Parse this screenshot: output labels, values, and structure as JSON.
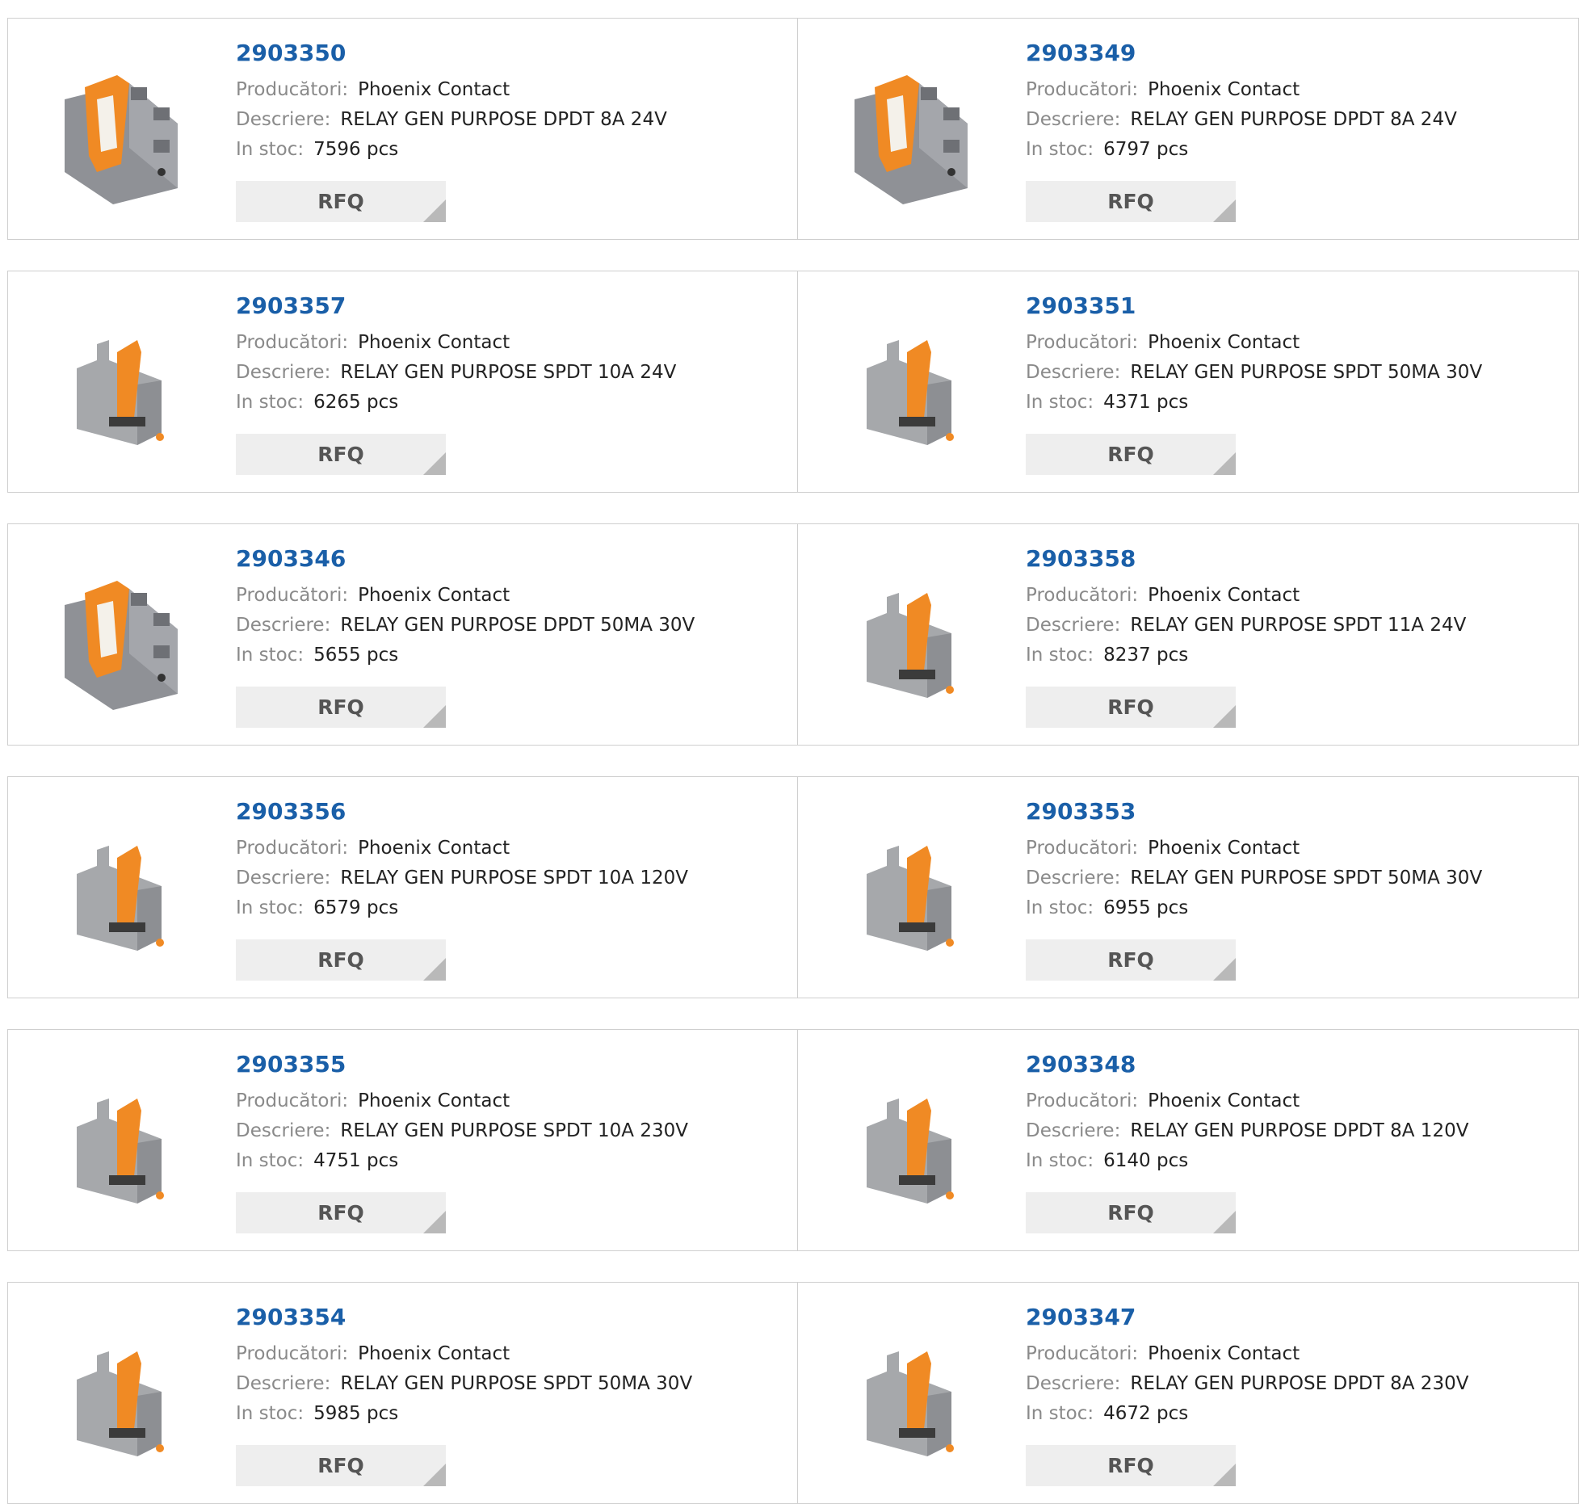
{
  "labels": {
    "manufacturer": "Producători:",
    "description": "Descriere:",
    "stock": "In stoc:",
    "rfq": "RFQ"
  },
  "products": [
    {
      "part": "2903350",
      "manufacturer": "Phoenix Contact",
      "description": "RELAY GEN PURPOSE DPDT 8A 24V",
      "stock": "7596 pcs",
      "image": "relay-dpdt-icon"
    },
    {
      "part": "2903349",
      "manufacturer": "Phoenix Contact",
      "description": "RELAY GEN PURPOSE DPDT 8A 24V",
      "stock": "6797 pcs",
      "image": "relay-dpdt-icon"
    },
    {
      "part": "2903357",
      "manufacturer": "Phoenix Contact",
      "description": "RELAY GEN PURPOSE SPDT 10A 24V",
      "stock": "6265 pcs",
      "image": "relay-spdt-icon"
    },
    {
      "part": "2903351",
      "manufacturer": "Phoenix Contact",
      "description": "RELAY GEN PURPOSE SPDT 50MA 30V",
      "stock": "4371 pcs",
      "image": "relay-spdt-icon"
    },
    {
      "part": "2903346",
      "manufacturer": "Phoenix Contact",
      "description": "RELAY GEN PURPOSE DPDT 50MA 30V",
      "stock": "5655 pcs",
      "image": "relay-dpdt-icon"
    },
    {
      "part": "2903358",
      "manufacturer": "Phoenix Contact",
      "description": "RELAY GEN PURPOSE SPDT 11A 24V",
      "stock": "8237 pcs",
      "image": "relay-spdt-icon"
    },
    {
      "part": "2903356",
      "manufacturer": "Phoenix Contact",
      "description": "RELAY GEN PURPOSE SPDT 10A 120V",
      "stock": "6579 pcs",
      "image": "relay-spdt-icon"
    },
    {
      "part": "2903353",
      "manufacturer": "Phoenix Contact",
      "description": "RELAY GEN PURPOSE SPDT 50MA 30V",
      "stock": "6955 pcs",
      "image": "relay-spdt-icon"
    },
    {
      "part": "2903355",
      "manufacturer": "Phoenix Contact",
      "description": "RELAY GEN PURPOSE SPDT 10A 230V",
      "stock": "4751 pcs",
      "image": "relay-spdt-icon"
    },
    {
      "part": "2903348",
      "manufacturer": "Phoenix Contact",
      "description": "RELAY GEN PURPOSE DPDT 8A 120V",
      "stock": "6140 pcs",
      "image": "relay-spdt-icon"
    },
    {
      "part": "2903354",
      "manufacturer": "Phoenix Contact",
      "description": "RELAY GEN PURPOSE SPDT 50MA 30V",
      "stock": "5985 pcs",
      "image": "relay-spdt-icon"
    },
    {
      "part": "2903347",
      "manufacturer": "Phoenix Contact",
      "description": "RELAY GEN PURPOSE DPDT 8A 230V",
      "stock": "4672 pcs",
      "image": "relay-spdt-icon"
    }
  ],
  "colors": {
    "link": "#1a5fa8",
    "label": "#8a8a8a",
    "border": "#cfcfcf",
    "button_bg": "#eeeeee",
    "relay_orange": "#f08a24",
    "relay_gray": "#8f9196"
  }
}
